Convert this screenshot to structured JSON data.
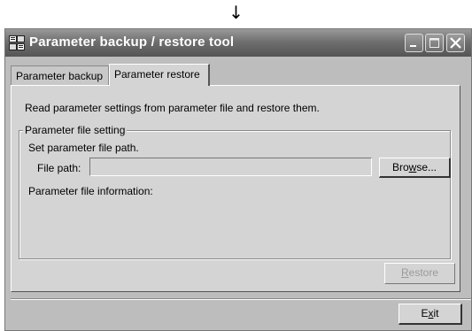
{
  "arrow_glyph": "↓",
  "window": {
    "title": "Parameter backup / restore tool",
    "controls": [
      "minimize-icon",
      "maximize-icon",
      "close-icon"
    ]
  },
  "tabs": [
    {
      "label": "Parameter backup",
      "active": false
    },
    {
      "label": "Parameter restore",
      "active": true
    }
  ],
  "restore_tab": {
    "description": "Read parameter settings from parameter file and restore them.",
    "group_title": "Parameter file setting",
    "set_path_text": "Set parameter file path.",
    "file_path_label": "File path:",
    "file_path_value": "",
    "browse_button": {
      "pre": "Bro",
      "key": "w",
      "post": "se..."
    },
    "file_info_label": "Parameter file information:",
    "restore_button": {
      "pre": "",
      "key": "R",
      "post": "estore",
      "enabled": false
    }
  },
  "exit_button": {
    "pre": "E",
    "key": "x",
    "post": "it"
  }
}
